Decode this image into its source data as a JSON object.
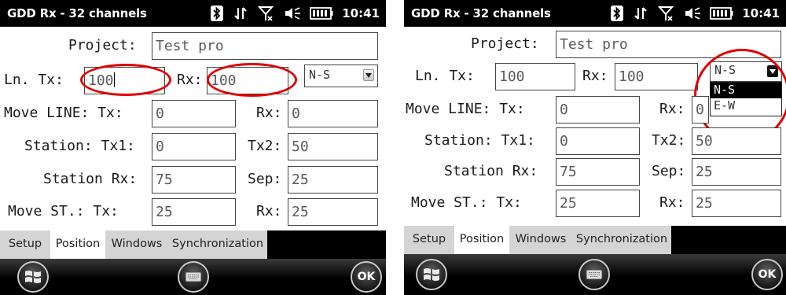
{
  "left": {
    "title": "GDD Rx - 32 channels",
    "clock": "10:41",
    "project": {
      "label": "Project:",
      "value": "Test pro"
    },
    "line": {
      "label": "Ln. Tx:",
      "tx_value": "100",
      "rx_label": "Rx:",
      "rx_value": "100",
      "direction": "N-S"
    },
    "move_line": {
      "label": "Move LINE: Tx:",
      "tx_value": "0",
      "rx_label": "Rx:",
      "rx_value": "0"
    },
    "station": {
      "label": "Station: Tx1:",
      "tx1_value": "0",
      "tx2_label": "Tx2:",
      "tx2_value": "50"
    },
    "station_rx": {
      "label": "Station Rx:",
      "value": "75",
      "sep_label": "Sep:",
      "sep_value": "25"
    },
    "move_st": {
      "label": "Move ST.: Tx:",
      "tx_value": "25",
      "rx_label": "Rx:",
      "rx_value": "25"
    },
    "tabs": [
      "Setup",
      "Position",
      "Windows",
      "Synchronization"
    ],
    "active_tab": "Position",
    "ok_label": "OK"
  },
  "right": {
    "title": "GDD Rx - 32 channels",
    "clock": "10:41",
    "project": {
      "label": "Project:",
      "value": "Test pro"
    },
    "line": {
      "label": "Ln. Tx:",
      "tx_value": "100",
      "rx_label": "Rx:",
      "rx_value": "100",
      "direction": "N-S"
    },
    "direction_options": [
      "N-S",
      "E-W"
    ],
    "selected_option": "N-S",
    "move_line": {
      "label": "Move LINE: Tx:",
      "tx_value": "0",
      "rx_label": "Rx:",
      "rx_value": "0"
    },
    "station": {
      "label": "Station: Tx1:",
      "tx1_value": "0",
      "tx2_label": "Tx2:",
      "tx2_value": "50"
    },
    "station_rx": {
      "label": "Station Rx:",
      "value": "75",
      "sep_label": "Sep:",
      "sep_value": "25"
    },
    "move_st": {
      "label": "Move ST.: Tx:",
      "tx_value": "25",
      "rx_label": "Rx:",
      "rx_value": "25"
    },
    "tabs": [
      "Setup",
      "Position",
      "Windows",
      "Synchronization"
    ],
    "active_tab": "Position",
    "ok_label": "OK"
  },
  "icons": [
    "bluetooth-icon",
    "sync-arrows-icon",
    "no-signal-icon",
    "speaker-icon",
    "battery-icon",
    "windows-start-icon",
    "keyboard-icon"
  ],
  "colors": {
    "annotation": "#e00000",
    "titlebar": "#000000",
    "active_tab": "#ffffff",
    "inactive_tab": "#d4d4d4"
  }
}
